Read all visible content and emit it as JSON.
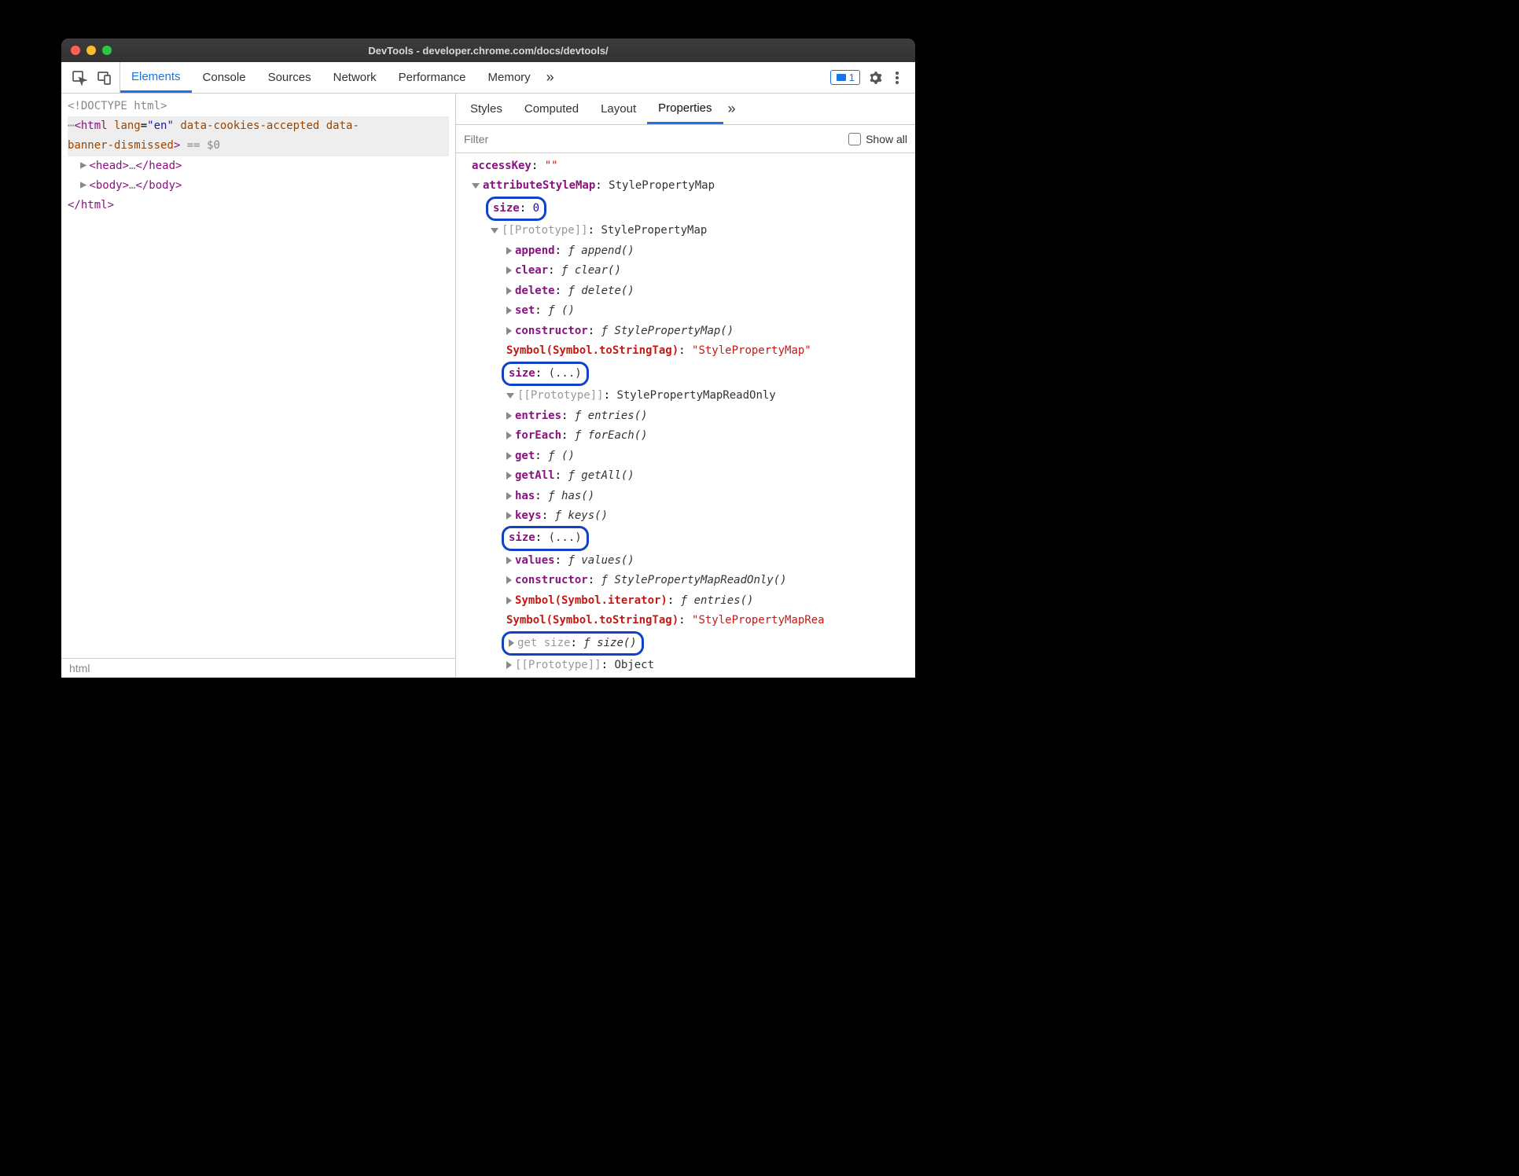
{
  "window": {
    "title": "DevTools - developer.chrome.com/docs/devtools/"
  },
  "toolbar": {
    "tabs": [
      "Elements",
      "Console",
      "Sources",
      "Network",
      "Performance",
      "Memory"
    ],
    "active_tab": 0,
    "issues_count": "1"
  },
  "dom": {
    "doctype": "<!DOCTYPE html>",
    "html_open": {
      "tag": "html",
      "attrs_text": "lang=\"en\" data-cookies-accepted data-banner-dismissed",
      "suffix": " == $0"
    },
    "head": {
      "tag_open": "<head>",
      "ellipsis": "…",
      "tag_close": "</head>"
    },
    "body": {
      "tag_open": "<body>",
      "ellipsis": "…",
      "tag_close": "</body>"
    },
    "html_close": "</html>",
    "breadcrumb": "html"
  },
  "side": {
    "tabs": [
      "Styles",
      "Computed",
      "Layout",
      "Properties"
    ],
    "active_tab": 3,
    "filter_placeholder": "Filter",
    "showall_label": "Show all"
  },
  "props": [
    {
      "indent": 0,
      "arrow": "",
      "key": "accessKey",
      "keycls": "key",
      "val": "\"\"",
      "valcls": "val-str"
    },
    {
      "indent": 0,
      "arrow": "down",
      "green": true,
      "key": "attributeStyleMap",
      "keycls": "key",
      "val": "StylePropertyMap",
      "valcls": "val-obj"
    },
    {
      "indent": 1,
      "arrow": "",
      "rounded": true,
      "key": "size",
      "keycls": "key",
      "val": "0",
      "valcls": "val-num"
    },
    {
      "indent": 1,
      "arrow": "down",
      "green": true,
      "key": "[[Prototype]]",
      "keycls": "key faint",
      "val": "StylePropertyMap",
      "valcls": "val-obj"
    },
    {
      "indent": 2,
      "arrow": "right",
      "key": "append",
      "keycls": "key",
      "fn": "append()"
    },
    {
      "indent": 2,
      "arrow": "right",
      "key": "clear",
      "keycls": "key",
      "fn": "clear()"
    },
    {
      "indent": 2,
      "arrow": "right",
      "key": "delete",
      "keycls": "key",
      "fn": "delete()"
    },
    {
      "indent": 2,
      "arrow": "right",
      "key": "set",
      "keycls": "key",
      "fn": "()"
    },
    {
      "indent": 2,
      "arrow": "right",
      "key": "constructor",
      "keycls": "key",
      "fn": "StylePropertyMap()"
    },
    {
      "indent": 2,
      "arrow": "",
      "sym": "Symbol(Symbol.toStringTag)",
      "val": "\"StylePropertyMap\"",
      "valcls": "val-str"
    },
    {
      "indent": 2,
      "arrow": "",
      "rounded": true,
      "key": "size",
      "keycls": "key",
      "val": "(...)",
      "valcls": "val-obj"
    },
    {
      "indent": 2,
      "arrow": "down",
      "green": true,
      "key": "[[Prototype]]",
      "keycls": "key faint",
      "val": "StylePropertyMapReadOnly",
      "valcls": "val-obj"
    },
    {
      "indent": 3,
      "arrow": "right",
      "key": "entries",
      "keycls": "key",
      "fn": "entries()"
    },
    {
      "indent": 3,
      "arrow": "right",
      "key": "forEach",
      "keycls": "key",
      "fn": "forEach()"
    },
    {
      "indent": 3,
      "arrow": "right",
      "key": "get",
      "keycls": "key",
      "fn": "()"
    },
    {
      "indent": 3,
      "arrow": "right",
      "key": "getAll",
      "keycls": "key",
      "fn": "getAll()"
    },
    {
      "indent": 3,
      "arrow": "right",
      "key": "has",
      "keycls": "key",
      "fn": "has()"
    },
    {
      "indent": 3,
      "arrow": "right",
      "key": "keys",
      "keycls": "key",
      "fn": "keys()"
    },
    {
      "indent": 3,
      "arrow": "",
      "rounded": true,
      "key": "size",
      "keycls": "key",
      "val": "(...)",
      "valcls": "val-obj"
    },
    {
      "indent": 3,
      "arrow": "right",
      "key": "values",
      "keycls": "key",
      "fn": "values()"
    },
    {
      "indent": 3,
      "arrow": "right",
      "key": "constructor",
      "keycls": "key",
      "fn": "StylePropertyMapReadOnly()"
    },
    {
      "indent": 3,
      "arrow": "right",
      "sym": "Symbol(Symbol.iterator)",
      "fn": "entries()"
    },
    {
      "indent": 3,
      "arrow": "",
      "sym": "Symbol(Symbol.toStringTag)",
      "val": "\"StylePropertyMapRea",
      "valcls": "val-str",
      "nocloseq": true
    },
    {
      "indent": 3,
      "arrow": "right",
      "rounded": true,
      "key": "get size",
      "keycls": "key faint",
      "fn": "size()"
    },
    {
      "indent": 3,
      "arrow": "right",
      "key": "[[Prototype]]",
      "keycls": "key faint",
      "val": "Object",
      "valcls": "val-obj"
    }
  ]
}
